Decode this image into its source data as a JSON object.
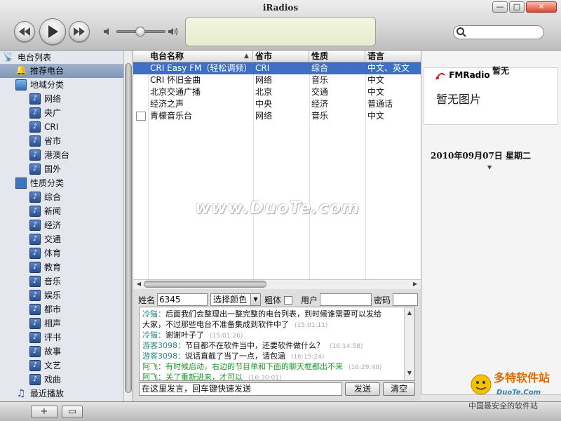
{
  "window": {
    "title": "iRadios",
    "controls": {
      "minimize": "—",
      "maximize": "□",
      "close": "✕"
    }
  },
  "toolbar": {
    "icons": [
      "rewind-icon",
      "play-icon",
      "forward-icon",
      "volume-low-icon",
      "volume-high-icon",
      "search-icon"
    ]
  },
  "sidebar": {
    "root": "电台列表",
    "recommended": "推荐电台",
    "region": "地域分类",
    "region_items": [
      "网络",
      "央广",
      "CRI",
      "省市",
      "港澳台",
      "国外"
    ],
    "nature": "性质分类",
    "nature_items": [
      "综合",
      "新闻",
      "经济",
      "交通",
      "体育",
      "教育",
      "音乐",
      "娱乐",
      "都市",
      "相声",
      "评书",
      "故事",
      "文艺",
      "戏曲"
    ],
    "recent": "最近播放"
  },
  "table": {
    "headers": [
      "电台名称",
      "省市",
      "性质",
      "语言"
    ],
    "rows": [
      [
        "CRI Easy FM（轻松调频）",
        "CRI",
        "综合",
        "中文、英文"
      ],
      [
        "CRI 怀旧金曲",
        "网络",
        "音乐",
        "中文"
      ],
      [
        "北京交通广播",
        "北京",
        "交通",
        "中文"
      ],
      [
        "经济之声",
        "中央",
        "经济",
        "普通话"
      ],
      [
        "青檬音乐台",
        "网络",
        "音乐",
        "中文"
      ]
    ]
  },
  "chat": {
    "name_label": "姓名",
    "name_value": "6345",
    "color_select": "选择颜色",
    "bold_label": "粗体",
    "user_label": "用户",
    "password_label": "密码",
    "log": [
      {
        "who": "冷猫：",
        "msg": "后面我们会整理出一整完整的电台列表，到时候谁需要可以发给",
        "ts": ""
      },
      {
        "who": "",
        "msg": "大家，不过那些电台不准备集成到软件中了",
        "ts": "(15:01:11)"
      },
      {
        "who": "冷猫：",
        "msg": "谢谢叶子了",
        "ts": "(15:01:26)"
      },
      {
        "who": "游客3098：",
        "msg": "节目都不在软件当中，还要软件做什么？",
        "ts": "(16:14:58)"
      },
      {
        "who": "游客3098：",
        "msg": "说话直截了当了一点，请包涵",
        "ts": "(16:15:24)"
      },
      {
        "who": "阿飞：",
        "msg": "有时候启动，右边的节目单和下面的聊天框都出不来",
        "ts": "(16:29:40)"
      },
      {
        "who": "阿飞：",
        "msg": "关了重新进来，才可以",
        "ts": "(16:30:01)"
      }
    ],
    "input_placeholder": "在这里发言，回车键快速发送",
    "send": "发送",
    "clear": "清空"
  },
  "info": {
    "station": "暂无",
    "logo_text": "FMRadio",
    "no_image": "暂无图片",
    "date": "2010年09月07日  星期二"
  },
  "status": {
    "add": "+",
    "window": "▭"
  },
  "watermark": "www.DuoTe.com",
  "corner_logo": {
    "line1": "多特软件站",
    "line2": "DuoTe.Com",
    "line3": "中国最安全的软件站"
  },
  "colors": {
    "selection": "#3d6fc4",
    "sidebar_selection": "#8aa0c0",
    "chat_cyan": "#2d8a8a",
    "chat_green": "#1a9a2a"
  }
}
